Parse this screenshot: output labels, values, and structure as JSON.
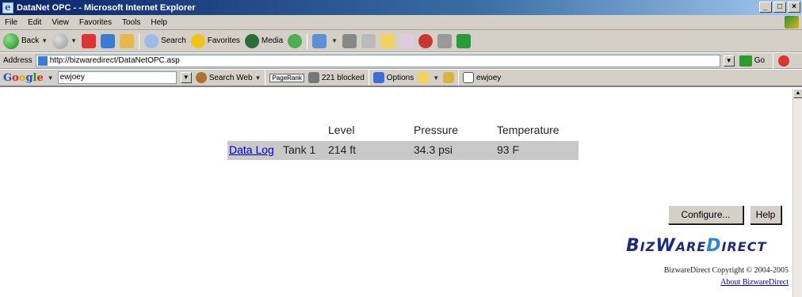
{
  "window": {
    "title": "DataNet OPC - - Microsoft Internet Explorer"
  },
  "menu": [
    "File",
    "Edit",
    "View",
    "Favorites",
    "Tools",
    "Help"
  ],
  "toolbar": {
    "back_label": "Back",
    "search_label": "Search",
    "favorites_label": "Favorites",
    "media_label": "Media"
  },
  "address": {
    "label": "Address",
    "url": "http://bizwaredirect/DataNetOPC.asp",
    "go_label": "Go"
  },
  "google": {
    "logo_letters": [
      "G",
      "o",
      "o",
      "g",
      "l",
      "e"
    ],
    "query": "ewjoey",
    "search_web_label": "Search Web",
    "pagerank_label": "PageRank",
    "blocked_label": "221 blocked",
    "options_label": "Options",
    "user_label": "ewjoey"
  },
  "table": {
    "headers": [
      "Level",
      "Pressure",
      "Temperature"
    ],
    "row": {
      "link": "Data Log",
      "tank": "Tank 1",
      "level": "214 ft",
      "pressure": "34.3 psi",
      "temperature": "93 F"
    }
  },
  "buttons": {
    "configure": "Configure...",
    "help": "Help"
  },
  "brand": {
    "part1": "B",
    "part2": "IZ",
    "part3": "W",
    "part4": "ARE",
    "part5": "D",
    "part6": "IRECT",
    "copyright": "BizwareDirect Copyright © 2004-2005",
    "about": "About BizwareDirect"
  }
}
